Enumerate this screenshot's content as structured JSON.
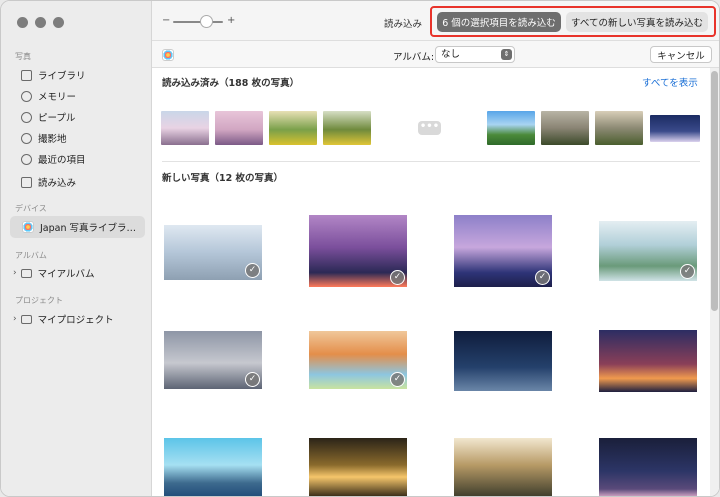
{
  "sidebar": {
    "sections": {
      "photos": "写真",
      "devices": "デバイス",
      "albums": "アルバム",
      "projects": "プロジェクト"
    },
    "items": [
      {
        "label": "ライブラリ",
        "icon": "photo-library-icon"
      },
      {
        "label": "メモリー",
        "icon": "memories-icon"
      },
      {
        "label": "ピープル",
        "icon": "people-icon"
      },
      {
        "label": "撮影地",
        "icon": "places-icon"
      },
      {
        "label": "最近の項目",
        "icon": "recents-icon"
      },
      {
        "label": "読み込み",
        "icon": "imports-icon"
      }
    ],
    "device": {
      "label": "Japan 写真ライブラ…",
      "icon": "photos-app-icon"
    },
    "albums": [
      {
        "label": "マイアルバム",
        "icon": "folder-icon"
      }
    ],
    "projects": [
      {
        "label": "マイプロジェクト",
        "icon": "folder-icon"
      }
    ]
  },
  "toolbar": {
    "zoom_minus": "−",
    "zoom_plus": "+",
    "import_label": "読み込み",
    "import_selected": "6 個の選択項目を読み込む",
    "import_all_new": "すべての新しい写真を読み込む"
  },
  "subbar": {
    "album_label": "アルバム:",
    "album_value": "なし",
    "cancel": "キャンセル"
  },
  "content": {
    "imported_title": "読み込み済み（188 枚の写真）",
    "show_all": "すべてを表示",
    "new_title": "新しい写真（12 枚の写真）",
    "more": "•••"
  },
  "colors": {
    "accent": "#1a6fd6",
    "primary_button": "#6e6e6e",
    "highlight_border": "#e8332a"
  }
}
